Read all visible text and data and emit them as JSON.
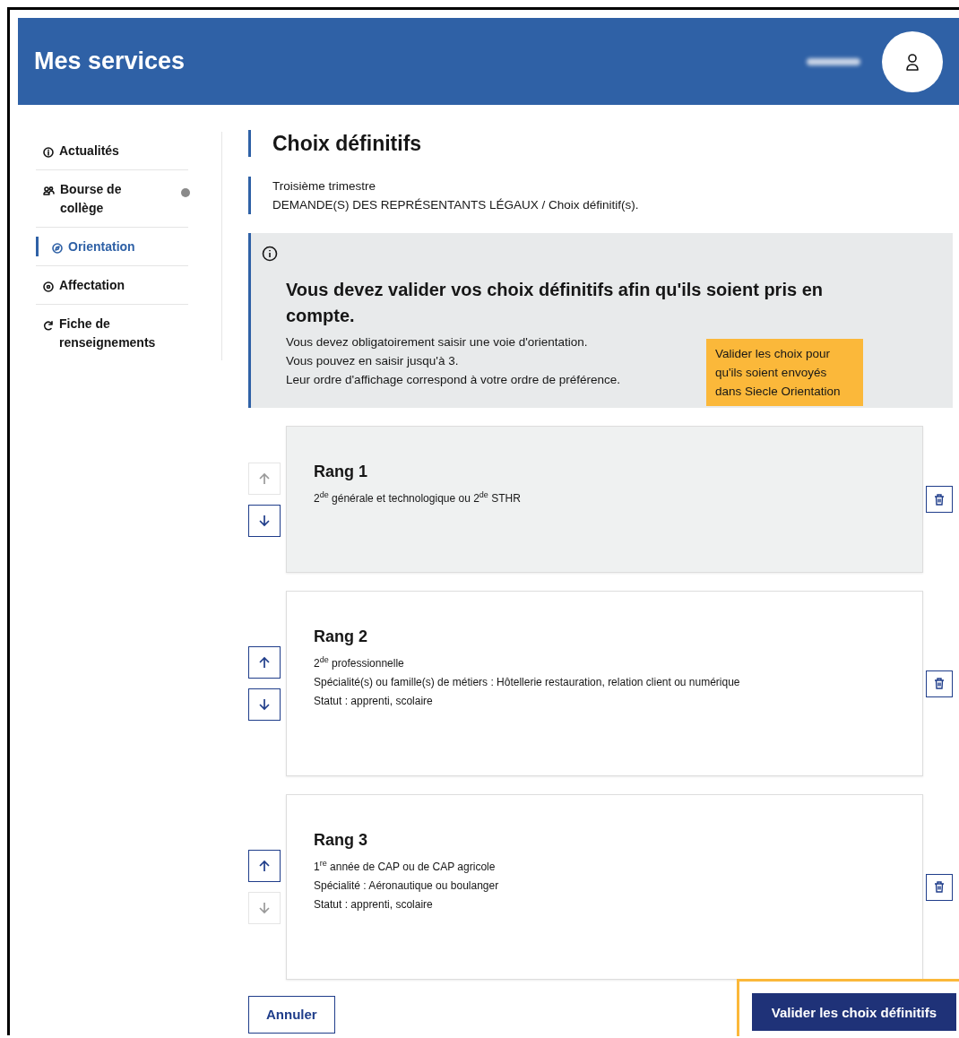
{
  "header": {
    "title": "Mes services"
  },
  "sidebar": {
    "items": [
      {
        "label": "Actualités",
        "selected": false,
        "badge": false
      },
      {
        "label": "Bourse de collège",
        "selected": false,
        "badge": true
      },
      {
        "label": "Orientation",
        "selected": true,
        "badge": false
      },
      {
        "label": "Affectation",
        "selected": false,
        "badge": false
      },
      {
        "label": "Fiche de renseignements",
        "selected": false,
        "badge": false
      }
    ]
  },
  "page": {
    "title": "Choix définitifs",
    "subtitle": "Troisième trimestre",
    "breadcrumb": "DEMANDE(S) DES REPRÉSENTANTS LÉGAUX / Choix définitif(s)."
  },
  "notice": {
    "title": "Vous devez valider vos choix définitifs afin qu'ils soient pris en compte.",
    "lines": [
      "Vous devez obligatoirement saisir une voie d'orientation.",
      "Vous pouvez en saisir jusqu'à 3.",
      "Leur ordre d'affichage correspond à votre ordre de préférence."
    ],
    "tooltip": "Valider les choix pour qu'ils soient envoyés dans Siecle Orientation"
  },
  "choices": [
    {
      "title": "Rang 1",
      "highlighted": true,
      "up_disabled": true,
      "down_disabled": false,
      "lines": [
        "2$^{de}$ générale et technologique ou 2$^{de}$ STHR"
      ]
    },
    {
      "title": "Rang 2",
      "highlighted": false,
      "up_disabled": false,
      "down_disabled": false,
      "lines": [
        "2$^{de}$ professionnelle",
        "Spécialité(s) ou famille(s) de métiers : Hôtellerie restauration, relation client ou numérique",
        "Statut : apprenti, scolaire"
      ]
    },
    {
      "title": "Rang 3",
      "highlighted": false,
      "up_disabled": false,
      "down_disabled": true,
      "lines": [
        "1$^{re}$ année de CAP ou de CAP agricole",
        "Spécialité : Aéronautique ou boulanger",
        "Statut : apprenti, scolaire"
      ]
    }
  ],
  "actions": {
    "cancel": "Annuler",
    "submit": "Valider les choix définitifs",
    "submit_highlighted": true
  }
}
